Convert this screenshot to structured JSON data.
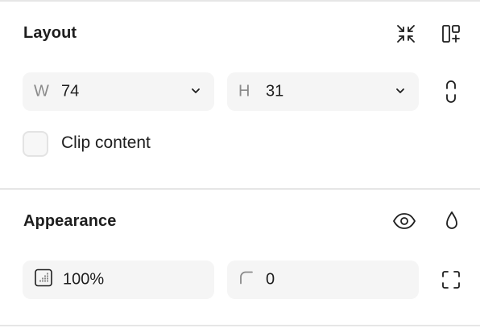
{
  "layout": {
    "title": "Layout",
    "width": {
      "prefix": "W",
      "value": "74"
    },
    "height": {
      "prefix": "H",
      "value": "31"
    },
    "clip_content_label": "Clip content",
    "clip_content_checked": false,
    "icons": {
      "collapse": "collapse-arrows-icon",
      "auto_layout": "auto-layout-add-icon",
      "constrain_proportions": "link-proportions-icon",
      "width_dropdown": "chevron-down-icon",
      "height_dropdown": "chevron-down-icon"
    }
  },
  "appearance": {
    "title": "Appearance",
    "opacity": "100%",
    "corner_radius": "0",
    "icons": {
      "visibility": "eye-icon",
      "blend": "drop-icon",
      "opacity": "opacity-grid-icon",
      "corner": "corner-radius-icon",
      "independent_corners": "corners-expand-icon"
    }
  }
}
